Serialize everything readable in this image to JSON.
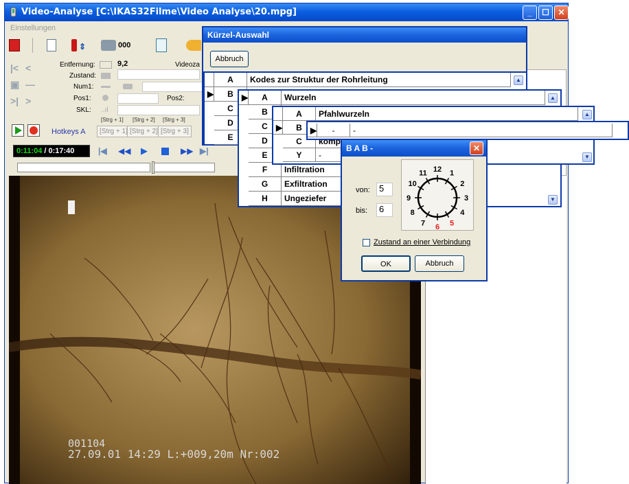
{
  "window": {
    "title": "Video-Analyse   [C:\\IKAS32Filme\\Video Analyse\\20.mpg]",
    "menu": "Einstellungen"
  },
  "toolbar": {
    "counter": "000",
    "videoz_label": "Videoza"
  },
  "info": {
    "entfernung_label": "Entfernung:",
    "entfernung_value": "9,2",
    "zustand_label": "Zustand:",
    "num1_label": "Num1:",
    "pos1_label": "Pos1:",
    "pos2_label": "Pos2:",
    "skl_label": "SKL:"
  },
  "hotkeys": {
    "label": "Hotkeys A",
    "keys": [
      "[Strg + 1]",
      "[Strg + 2]",
      "[Strg + 3]"
    ],
    "headers": [
      "[Strg + 1]",
      "[Strg + 2]",
      "[Strg + 3]"
    ]
  },
  "player": {
    "elapsed": "0:11:04",
    "total": "/ 0:17:40"
  },
  "osd": {
    "line1": "001104",
    "line2": "27.09.01  14:29  L:+009,20m  Nr:002"
  },
  "kuerzel": {
    "title": "Kürzel-Auswahl",
    "cancel": "Abbruch",
    "rows": [
      {
        "code": "A",
        "text": "Kodes zur Struktur der Rohrleitung"
      },
      {
        "code": "B",
        "text": ""
      },
      {
        "code": "C",
        "text": ""
      },
      {
        "code": "D",
        "text": ""
      },
      {
        "code": "E",
        "text": ""
      }
    ]
  },
  "level2": {
    "rows": [
      {
        "code": "A",
        "text": "Wurzeln"
      },
      {
        "code": "B",
        "text": ""
      },
      {
        "code": "C",
        "text": ""
      },
      {
        "code": "D",
        "text": ""
      },
      {
        "code": "E",
        "text": ""
      },
      {
        "code": "F",
        "text": "Infiltration"
      },
      {
        "code": "G",
        "text": "Exfiltration"
      },
      {
        "code": "H",
        "text": "Ungeziefer"
      }
    ]
  },
  "level3": {
    "rows": [
      {
        "code": "A",
        "text": "Pfahlwurzeln"
      },
      {
        "code": "B",
        "text": ""
      },
      {
        "code": "C",
        "text": "komp"
      },
      {
        "code": "Y",
        "text": "-"
      }
    ]
  },
  "level4": {
    "col1": "-",
    "col2": "-"
  },
  "bab": {
    "title": "B A B -",
    "von_label": "von:",
    "von_value": "5",
    "bis_label": "bis:",
    "bis_value": "6",
    "clock": [
      "12",
      "1",
      "2",
      "3",
      "4",
      "5",
      "6",
      "7",
      "8",
      "9",
      "10",
      "11"
    ],
    "checkbox_label": "Zustand an einer Verbindung",
    "ok": "OK",
    "cancel": "Abbruch",
    "highlight_color": "#e02020"
  }
}
